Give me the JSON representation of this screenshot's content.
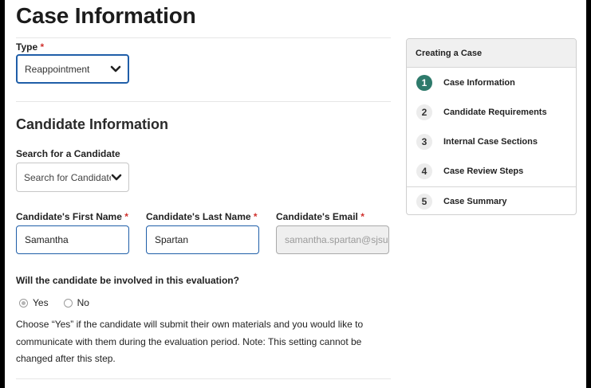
{
  "page": {
    "title": "Case Information"
  },
  "type_field": {
    "label": "Type",
    "required_mark": "*",
    "value": "Reappointment"
  },
  "candidate_section": {
    "title": "Candidate Information",
    "search": {
      "label": "Search for a Candidate",
      "value": "Search for Candidate"
    },
    "first_name": {
      "label": "Candidate's First Name",
      "required_mark": "*",
      "value": "Samantha"
    },
    "last_name": {
      "label": "Candidate's Last Name",
      "required_mark": "*",
      "value": "Spartan"
    },
    "email": {
      "label": "Candidate's Email",
      "required_mark": "*",
      "value": "samantha.spartan@sjsu"
    }
  },
  "involvement": {
    "question": "Will the candidate be involved in this evaluation?",
    "options": [
      {
        "label": "Yes",
        "checked": true
      },
      {
        "label": "No",
        "checked": false
      }
    ],
    "help_text": "Choose “Yes” if the candidate will submit their own materials and you would like to communicate with them during the evaluation period. Note: This setting cannot be changed after this step."
  },
  "steps_panel": {
    "heading": "Creating a Case",
    "steps": [
      {
        "number": "1",
        "label": "Case Information",
        "active": true
      },
      {
        "number": "2",
        "label": "Candidate Requirements",
        "active": false
      },
      {
        "number": "3",
        "label": "Internal Case Sections",
        "active": false
      },
      {
        "number": "4",
        "label": "Case Review Steps",
        "active": false
      },
      {
        "number": "5",
        "label": "Case Summary",
        "active": false
      }
    ]
  },
  "colors": {
    "accent_blue": "#1f5ea8",
    "active_step": "#2e7a6b",
    "required": "#d0312d"
  },
  "icons": {
    "dropdown": "chevron-down-icon"
  }
}
